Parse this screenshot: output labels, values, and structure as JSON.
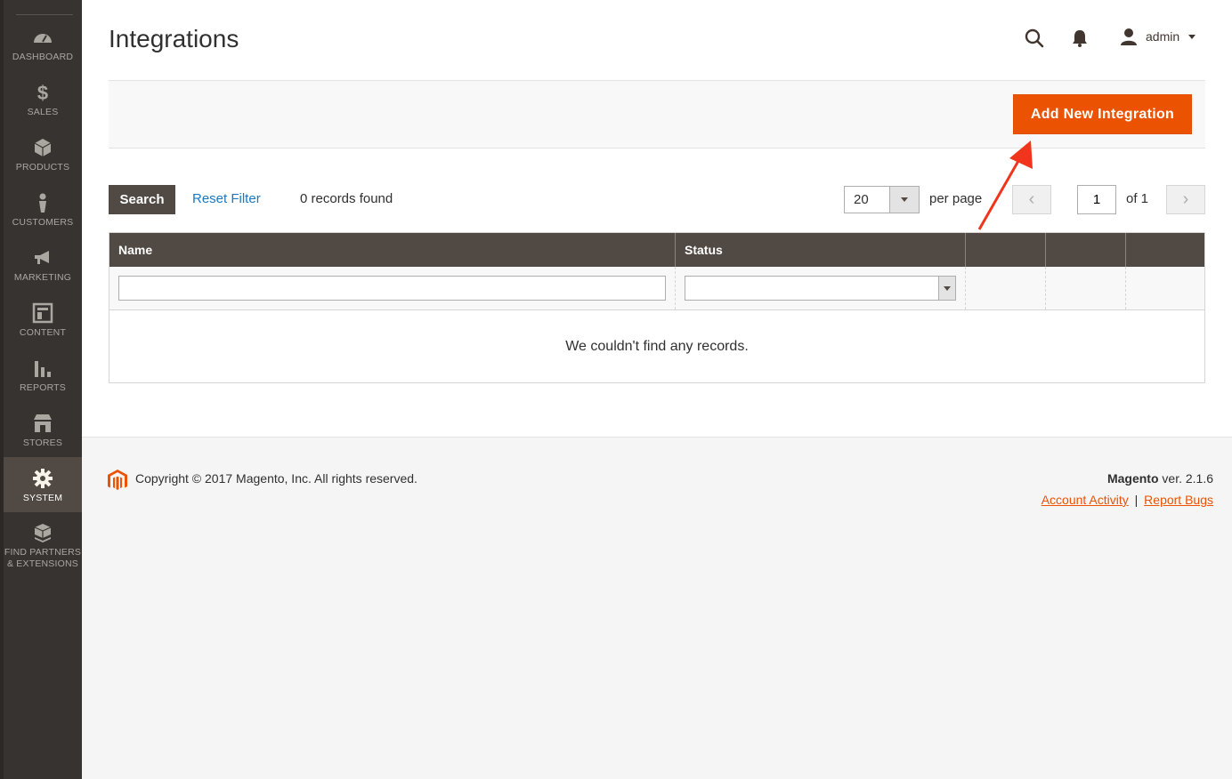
{
  "sidebar": {
    "items": [
      {
        "label": "DASHBOARD",
        "icon": "dashboard-icon"
      },
      {
        "label": "SALES",
        "icon": "dollar-icon"
      },
      {
        "label": "PRODUCTS",
        "icon": "cube-icon"
      },
      {
        "label": "CUSTOMERS",
        "icon": "person-icon"
      },
      {
        "label": "MARKETING",
        "icon": "megaphone-icon"
      },
      {
        "label": "CONTENT",
        "icon": "layout-icon"
      },
      {
        "label": "REPORTS",
        "icon": "bar-chart-icon"
      },
      {
        "label": "STORES",
        "icon": "store-icon"
      },
      {
        "label": "SYSTEM",
        "icon": "gear-icon",
        "active": true
      },
      {
        "label": "FIND PARTNERS",
        "label2": "& EXTENSIONS",
        "icon": "boxes-icon"
      }
    ]
  },
  "header": {
    "title": "Integrations",
    "user": "admin"
  },
  "actions": {
    "add_button": "Add New Integration"
  },
  "grid_controls": {
    "search_button": "Search",
    "reset_filter": "Reset Filter",
    "records_found": "0 records found",
    "per_page_value": "20",
    "per_page_label": "per page",
    "current_page": "1",
    "page_of": "of 1"
  },
  "grid": {
    "columns": [
      "Name",
      "Status",
      "",
      "",
      ""
    ],
    "empty_message": "We couldn't find any records."
  },
  "footer": {
    "copyright": "Copyright © 2017 Magento, Inc. All rights reserved.",
    "brand": "Magento",
    "version": " ver. 2.1.6",
    "link_activity": "Account Activity",
    "separator": "|",
    "link_bugs": "Report Bugs"
  },
  "colors": {
    "accent": "#eb5202",
    "sidebar": "#373330",
    "grid_header": "#514943",
    "link": "#1979c3"
  }
}
